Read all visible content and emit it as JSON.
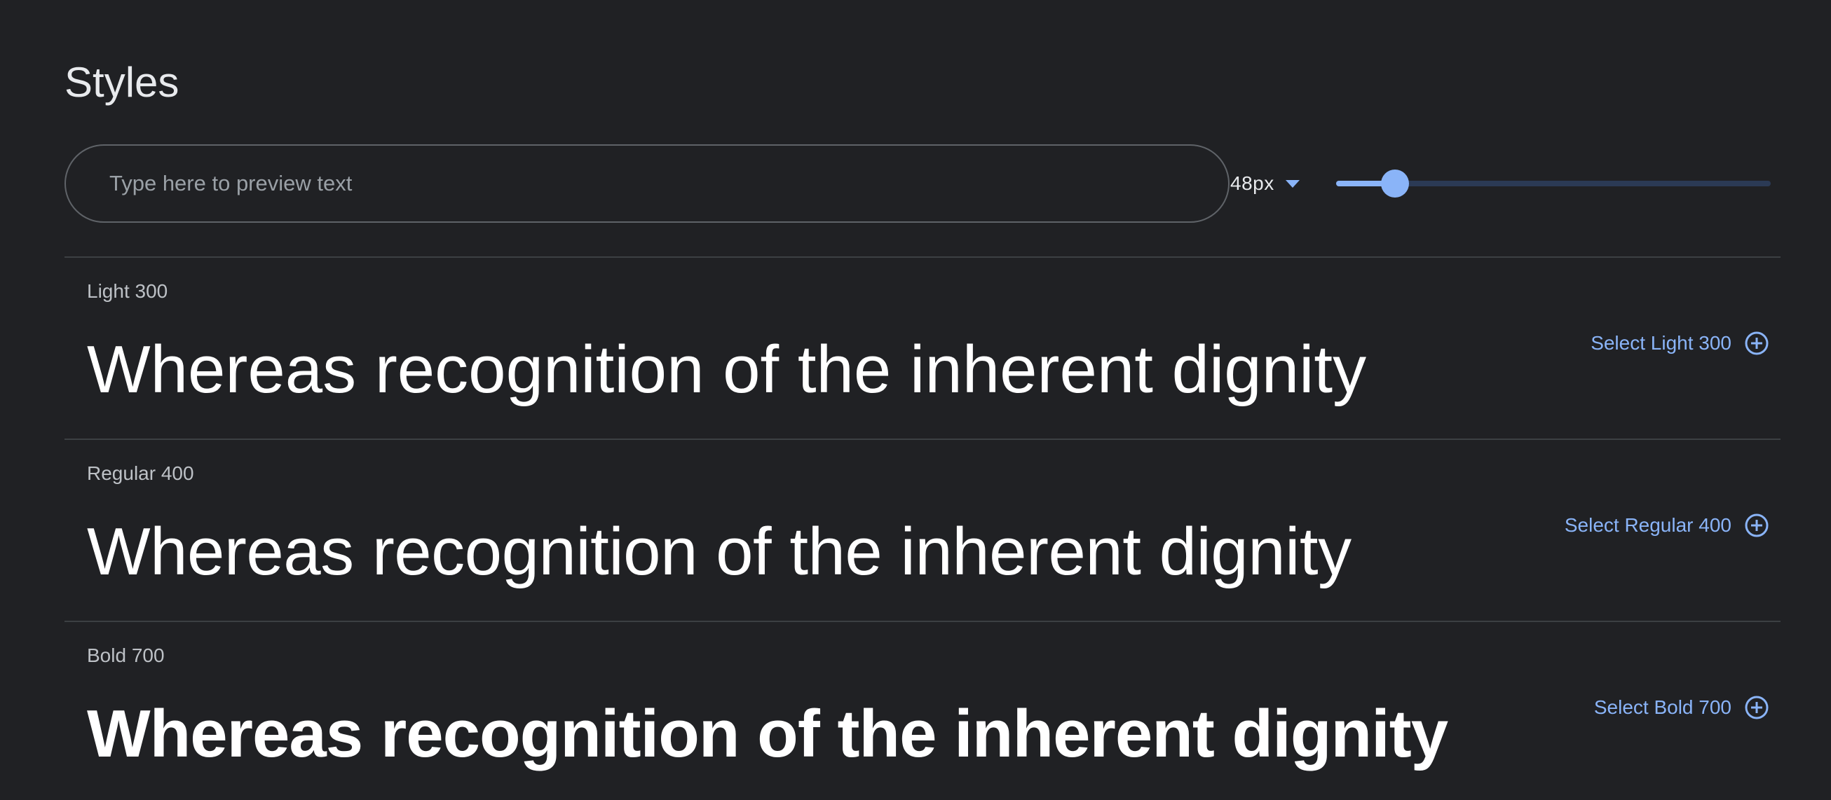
{
  "section": {
    "title": "Styles"
  },
  "preview": {
    "placeholder": "Type here to preview text"
  },
  "size": {
    "value": "48px",
    "slider_fraction": 0.135
  },
  "colors": {
    "background": "#202124",
    "accent": "#8ab4f8",
    "divider": "#3c4043"
  },
  "styles": [
    {
      "name": "Light 300",
      "sample": "Whereas recognition of the inherent dignity",
      "select_label": "Select Light 300",
      "icon": "add-circle-icon"
    },
    {
      "name": "Regular 400",
      "sample": "Whereas recognition of the inherent dignity",
      "select_label": "Select Regular 400",
      "icon": "add-circle-icon"
    },
    {
      "name": "Bold 700",
      "sample": "Whereas recognition of the inherent dignity",
      "select_label": "Select Bold 700",
      "icon": "add-circle-icon"
    }
  ]
}
